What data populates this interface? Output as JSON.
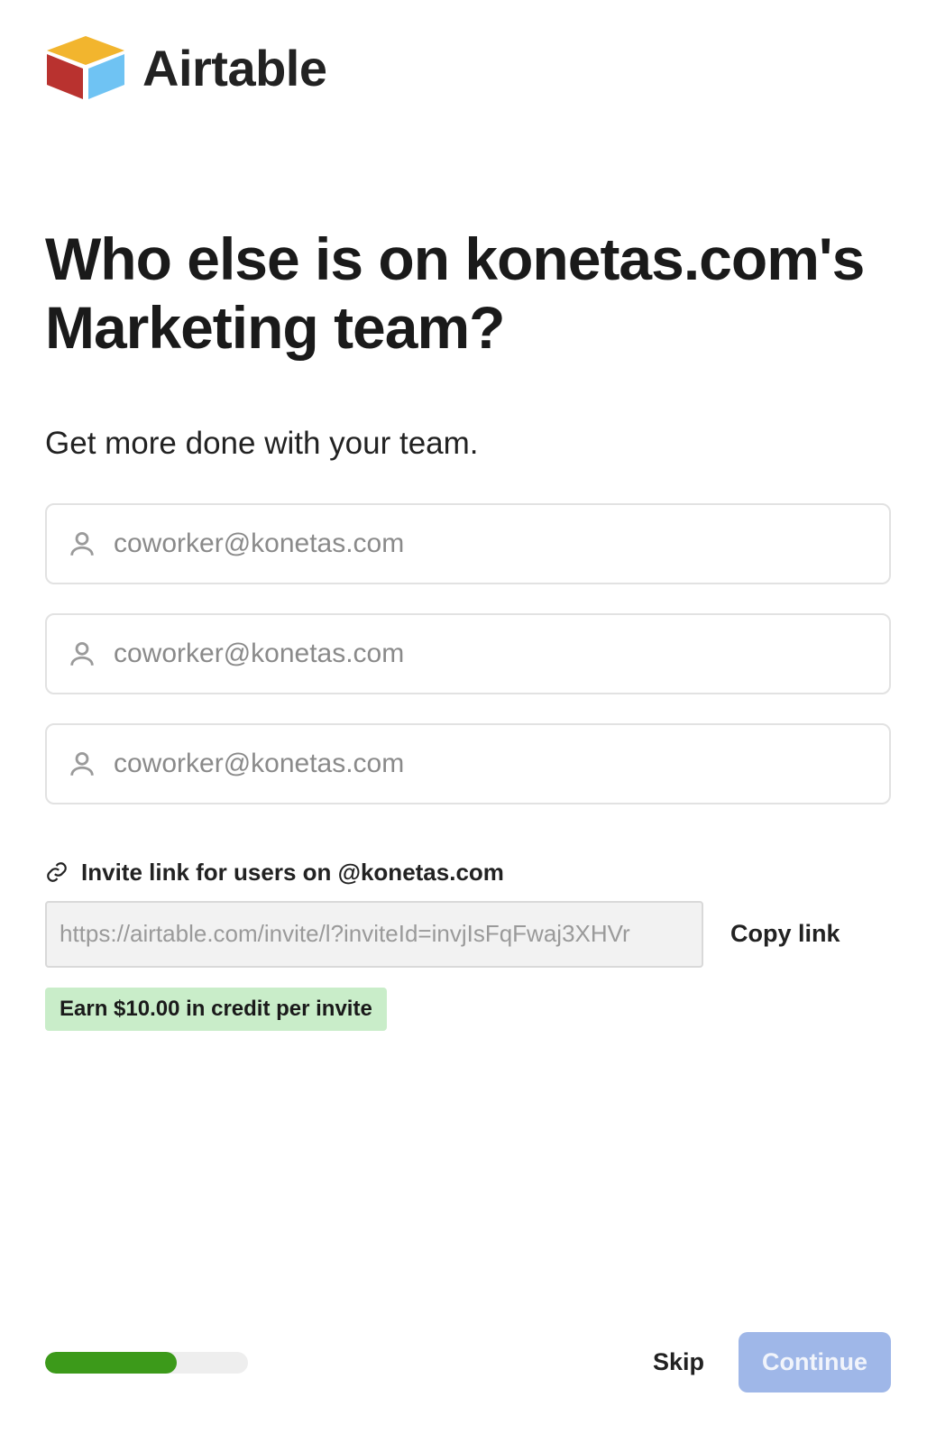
{
  "brand": {
    "name": "Airtable"
  },
  "headline": "Who else is on konetas.com's Marketing team?",
  "subhead": "Get more done with your team.",
  "email_inputs": [
    {
      "placeholder": "coworker@konetas.com",
      "value": ""
    },
    {
      "placeholder": "coworker@konetas.com",
      "value": ""
    },
    {
      "placeholder": "coworker@konetas.com",
      "value": ""
    }
  ],
  "invite": {
    "label": "Invite link for users on @konetas.com",
    "url": "https://airtable.com/invite/l?inviteId=invjIsFqFwaj3XHVr",
    "copy_label": "Copy link",
    "credit_badge": "Earn $10.00 in credit per invite"
  },
  "footer": {
    "progress_percent": 65,
    "skip_label": "Skip",
    "continue_label": "Continue"
  },
  "icons": {
    "person": "person-icon",
    "link": "link-icon"
  }
}
